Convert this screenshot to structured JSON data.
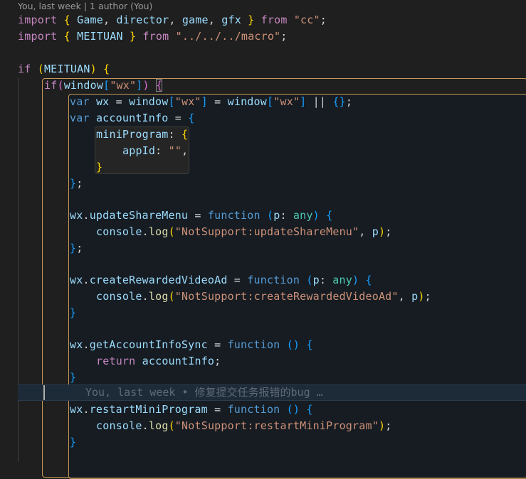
{
  "codelens": {
    "text": "You, last week | 1 author (You)"
  },
  "code": {
    "l1": {
      "t1": "import",
      "t2": " { ",
      "t3": "Game",
      "t4": ", ",
      "t5": "director",
      "t6": ", ",
      "t7": "game",
      "t8": ", ",
      "t9": "gfx",
      "t10": " } ",
      "t11": "from",
      "t12": " ",
      "t13": "\"cc\"",
      "t14": ";"
    },
    "l2": {
      "t1": "import",
      "t2": " { ",
      "t3": "MEITUAN",
      "t4": " } ",
      "t5": "from",
      "t6": " ",
      "t7": "\"../../../macro\"",
      "t8": ";"
    },
    "l4": {
      "t1": "if",
      "t2": " (",
      "t3": "MEITUAN",
      "t4": ") ",
      "t5": "{"
    },
    "l5": {
      "t1": "if",
      "t2": "(",
      "t3": "window",
      "t4": "[",
      "t5": "\"wx\"",
      "t6": "]",
      "t7": ") ",
      "t8": "{"
    },
    "l6": {
      "t1": "var",
      "t2": " ",
      "t3": "wx",
      "t4": " = ",
      "t5": "window",
      "t6": "[",
      "t7": "\"wx\"",
      "t8": "]",
      "t9": " = ",
      "t10": "window",
      "t11": "[",
      "t12": "\"wx\"",
      "t13": "]",
      "t14": " || ",
      "t15": "{}",
      "t16": ";"
    },
    "l7": {
      "t1": "var",
      "t2": " ",
      "t3": "accountInfo",
      "t4": " = ",
      "t5": "{"
    },
    "l8": {
      "t1": "miniProgram",
      "t2": ": ",
      "t3": "{"
    },
    "l9": {
      "t1": "appId",
      "t2": ": ",
      "t3": "\"\"",
      "t4": ","
    },
    "l10": {
      "t1": "}"
    },
    "l11": {
      "t1": "}",
      "t2": ";"
    },
    "l13": {
      "t1": "wx",
      "t2": ".",
      "t3": "updateShareMenu",
      "t4": " = ",
      "t5": "function",
      "t6": " ",
      "t7": "(",
      "t8": "p",
      "t9": ": ",
      "t10": "any",
      "t11": ")",
      "t12": " ",
      "t13": "{"
    },
    "l14": {
      "t1": "console",
      "t2": ".",
      "t3": "log",
      "t4": "(",
      "t5": "\"NotSupport:updateShareMenu\"",
      "t6": ", ",
      "t7": "p",
      "t8": ")",
      "t9": ";"
    },
    "l15": {
      "t1": "}",
      "t2": ";"
    },
    "l17": {
      "t1": "wx",
      "t2": ".",
      "t3": "createRewardedVideoAd",
      "t4": " = ",
      "t5": "function",
      "t6": " ",
      "t7": "(",
      "t8": "p",
      "t9": ": ",
      "t10": "any",
      "t11": ")",
      "t12": " ",
      "t13": "{"
    },
    "l18": {
      "t1": "console",
      "t2": ".",
      "t3": "log",
      "t4": "(",
      "t5": "\"NotSupport:createRewardedVideoAd\"",
      "t6": ", ",
      "t7": "p",
      "t8": ")",
      "t9": ";"
    },
    "l19": {
      "t1": "}"
    },
    "l21": {
      "t1": "wx",
      "t2": ".",
      "t3": "getAccountInfoSync",
      "t4": " = ",
      "t5": "function",
      "t6": " ",
      "t7": "()",
      "t8": " ",
      "t9": "{"
    },
    "l22": {
      "t1": "return",
      "t2": " ",
      "t3": "accountInfo",
      "t4": ";"
    },
    "l23": {
      "t1": "}"
    },
    "l24": {
      "blame": "You, last week • 修复提交任务报错的bug …"
    },
    "l25": {
      "t1": "wx",
      "t2": ".",
      "t3": "restartMiniProgram",
      "t4": " = ",
      "t5": "function",
      "t6": " ",
      "t7": "()",
      "t8": " ",
      "t9": "{"
    },
    "l26": {
      "t1": "console",
      "t2": ".",
      "t3": "log",
      "t4": "(",
      "t5": "\"NotSupport:restartMiniProgram\"",
      "t6": ")",
      "t7": ";"
    },
    "l27": {
      "t1": "}"
    }
  },
  "colors": {
    "background": "#1f1f1f",
    "keyword": "#569cd6",
    "control": "#c586c0",
    "string": "#ce9178",
    "variable": "#9cdcfe",
    "function": "#dcdcaa",
    "type": "#4ec9b0",
    "scope_border": "#c79a56"
  }
}
